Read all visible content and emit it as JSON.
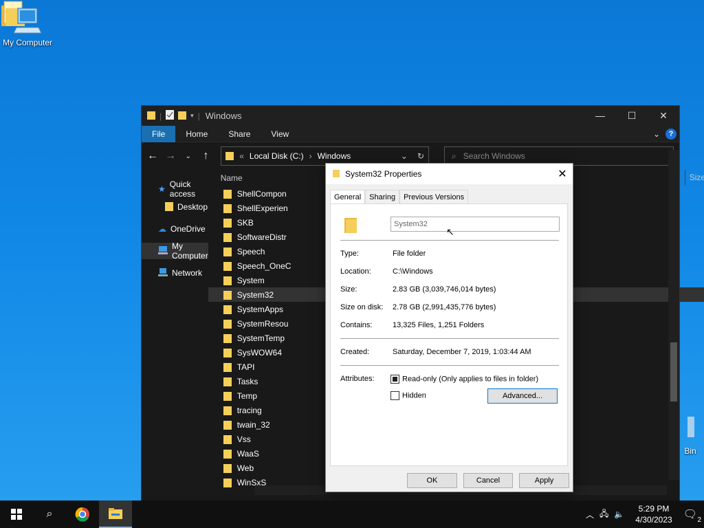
{
  "desktop": {
    "my_computer_label": "My Computer",
    "recycle_bin_label": "Bin"
  },
  "explorer": {
    "title": "Windows",
    "ribbon_tabs": [
      "File",
      "Home",
      "Share",
      "View"
    ],
    "address": {
      "root": "Local Disk (C:)",
      "folder": "Windows"
    },
    "search_placeholder": "Search Windows",
    "nav": {
      "quick_access": "Quick access",
      "desktop": "Desktop",
      "onedrive": "OneDrive",
      "my_computer": "My Computer",
      "network": "Network"
    },
    "columns": {
      "name": "Name",
      "size": "Size"
    },
    "files": [
      "ShellCompon",
      "ShellExperien",
      "SKB",
      "SoftwareDistr",
      "Speech",
      "Speech_OneC",
      "System",
      "System32",
      "SystemApps",
      "SystemResou",
      "SystemTemp",
      "SysWOW64",
      "TAPI",
      "Tasks",
      "Temp",
      "tracing",
      "twain_32",
      "Vss",
      "WaaS",
      "Web",
      "WinSxS"
    ],
    "selected_file": "System32"
  },
  "dialog": {
    "title": "System32 Properties",
    "tabs": [
      "General",
      "Sharing",
      "Previous Versions"
    ],
    "name_value": "System32",
    "props": {
      "type_k": "Type:",
      "type_v": "File folder",
      "location_k": "Location:",
      "location_v": "C:\\Windows",
      "size_k": "Size:",
      "size_v": "2.83 GB (3,039,746,014 bytes)",
      "disk_k": "Size on disk:",
      "disk_v": "2.78 GB (2,991,435,776 bytes)",
      "contains_k": "Contains:",
      "contains_v": "13,325 Files, 1,251 Folders",
      "created_k": "Created:",
      "created_v": "Saturday, December 7, 2019, 1:03:44 AM",
      "attributes_k": "Attributes:"
    },
    "readonly_label": "Read-only (Only applies to files in folder)",
    "hidden_label": "Hidden",
    "advanced_label": "Advanced...",
    "ok_label": "OK",
    "cancel_label": "Cancel",
    "apply_label": "Apply"
  },
  "taskbar": {
    "time": "5:29 PM",
    "date": "4/30/2023",
    "notifications": "2"
  }
}
